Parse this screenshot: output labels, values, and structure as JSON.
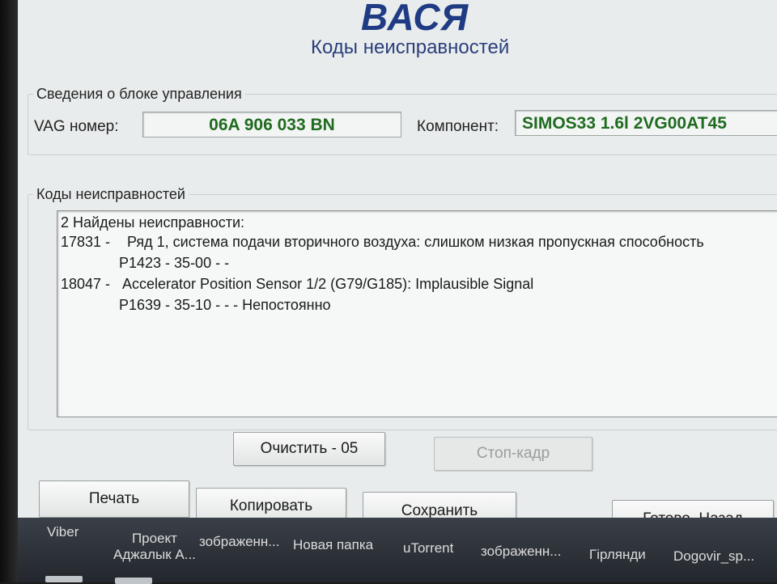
{
  "header": {
    "title": "ВАСЯ",
    "subtitle": "Коды неисправностей"
  },
  "control_unit": {
    "legend": "Сведения о блоке управления",
    "vag_label": "VAG номер:",
    "vag_number": "06A 906 033 BN",
    "component_label": "Компонент:",
    "component": "SIMOS33 1.6l 2VG00AT45"
  },
  "fault_codes": {
    "legend": "Коды неисправностей",
    "summary": "2 Найдены неисправности:",
    "entries": [
      {
        "code": "17831 -",
        "description": "Ряд 1, система подачи вторичного воздуха: слишком низкая пропускная способность",
        "detail": "P1423 - 35-00 -   -"
      },
      {
        "code": "18047 -",
        "description": "Accelerator Position Sensor 1/2 (G79/G185): Implausible Signal",
        "detail": "P1639 - 35-10 -   - - Непостоянно"
      }
    ]
  },
  "buttons": {
    "clear": "Очистить - 05",
    "freeze_frame": "Стоп-кадр",
    "print": "Печать",
    "copy": "Копировать",
    "save": "Сохранить",
    "done_back": "Готово, Назад"
  },
  "taskbar": {
    "items": [
      {
        "line1": "Viber",
        "line2": ""
      },
      {
        "line1": "Проект",
        "line2": "Аджалык А..."
      },
      {
        "line1": "зображенн...",
        "line2": ""
      },
      {
        "line1": "Новая папка",
        "line2": ""
      },
      {
        "line1": "uTorrent",
        "line2": ""
      },
      {
        "line1": "зображенн...",
        "line2": ""
      },
      {
        "line1": "Гірлянди",
        "line2": ""
      },
      {
        "line1": "Dogovir_sp...",
        "line2": ""
      }
    ]
  },
  "colors": {
    "title": "#1f3b84",
    "field_text": "#1f6b1f",
    "window_bg": "#e9ecec"
  }
}
